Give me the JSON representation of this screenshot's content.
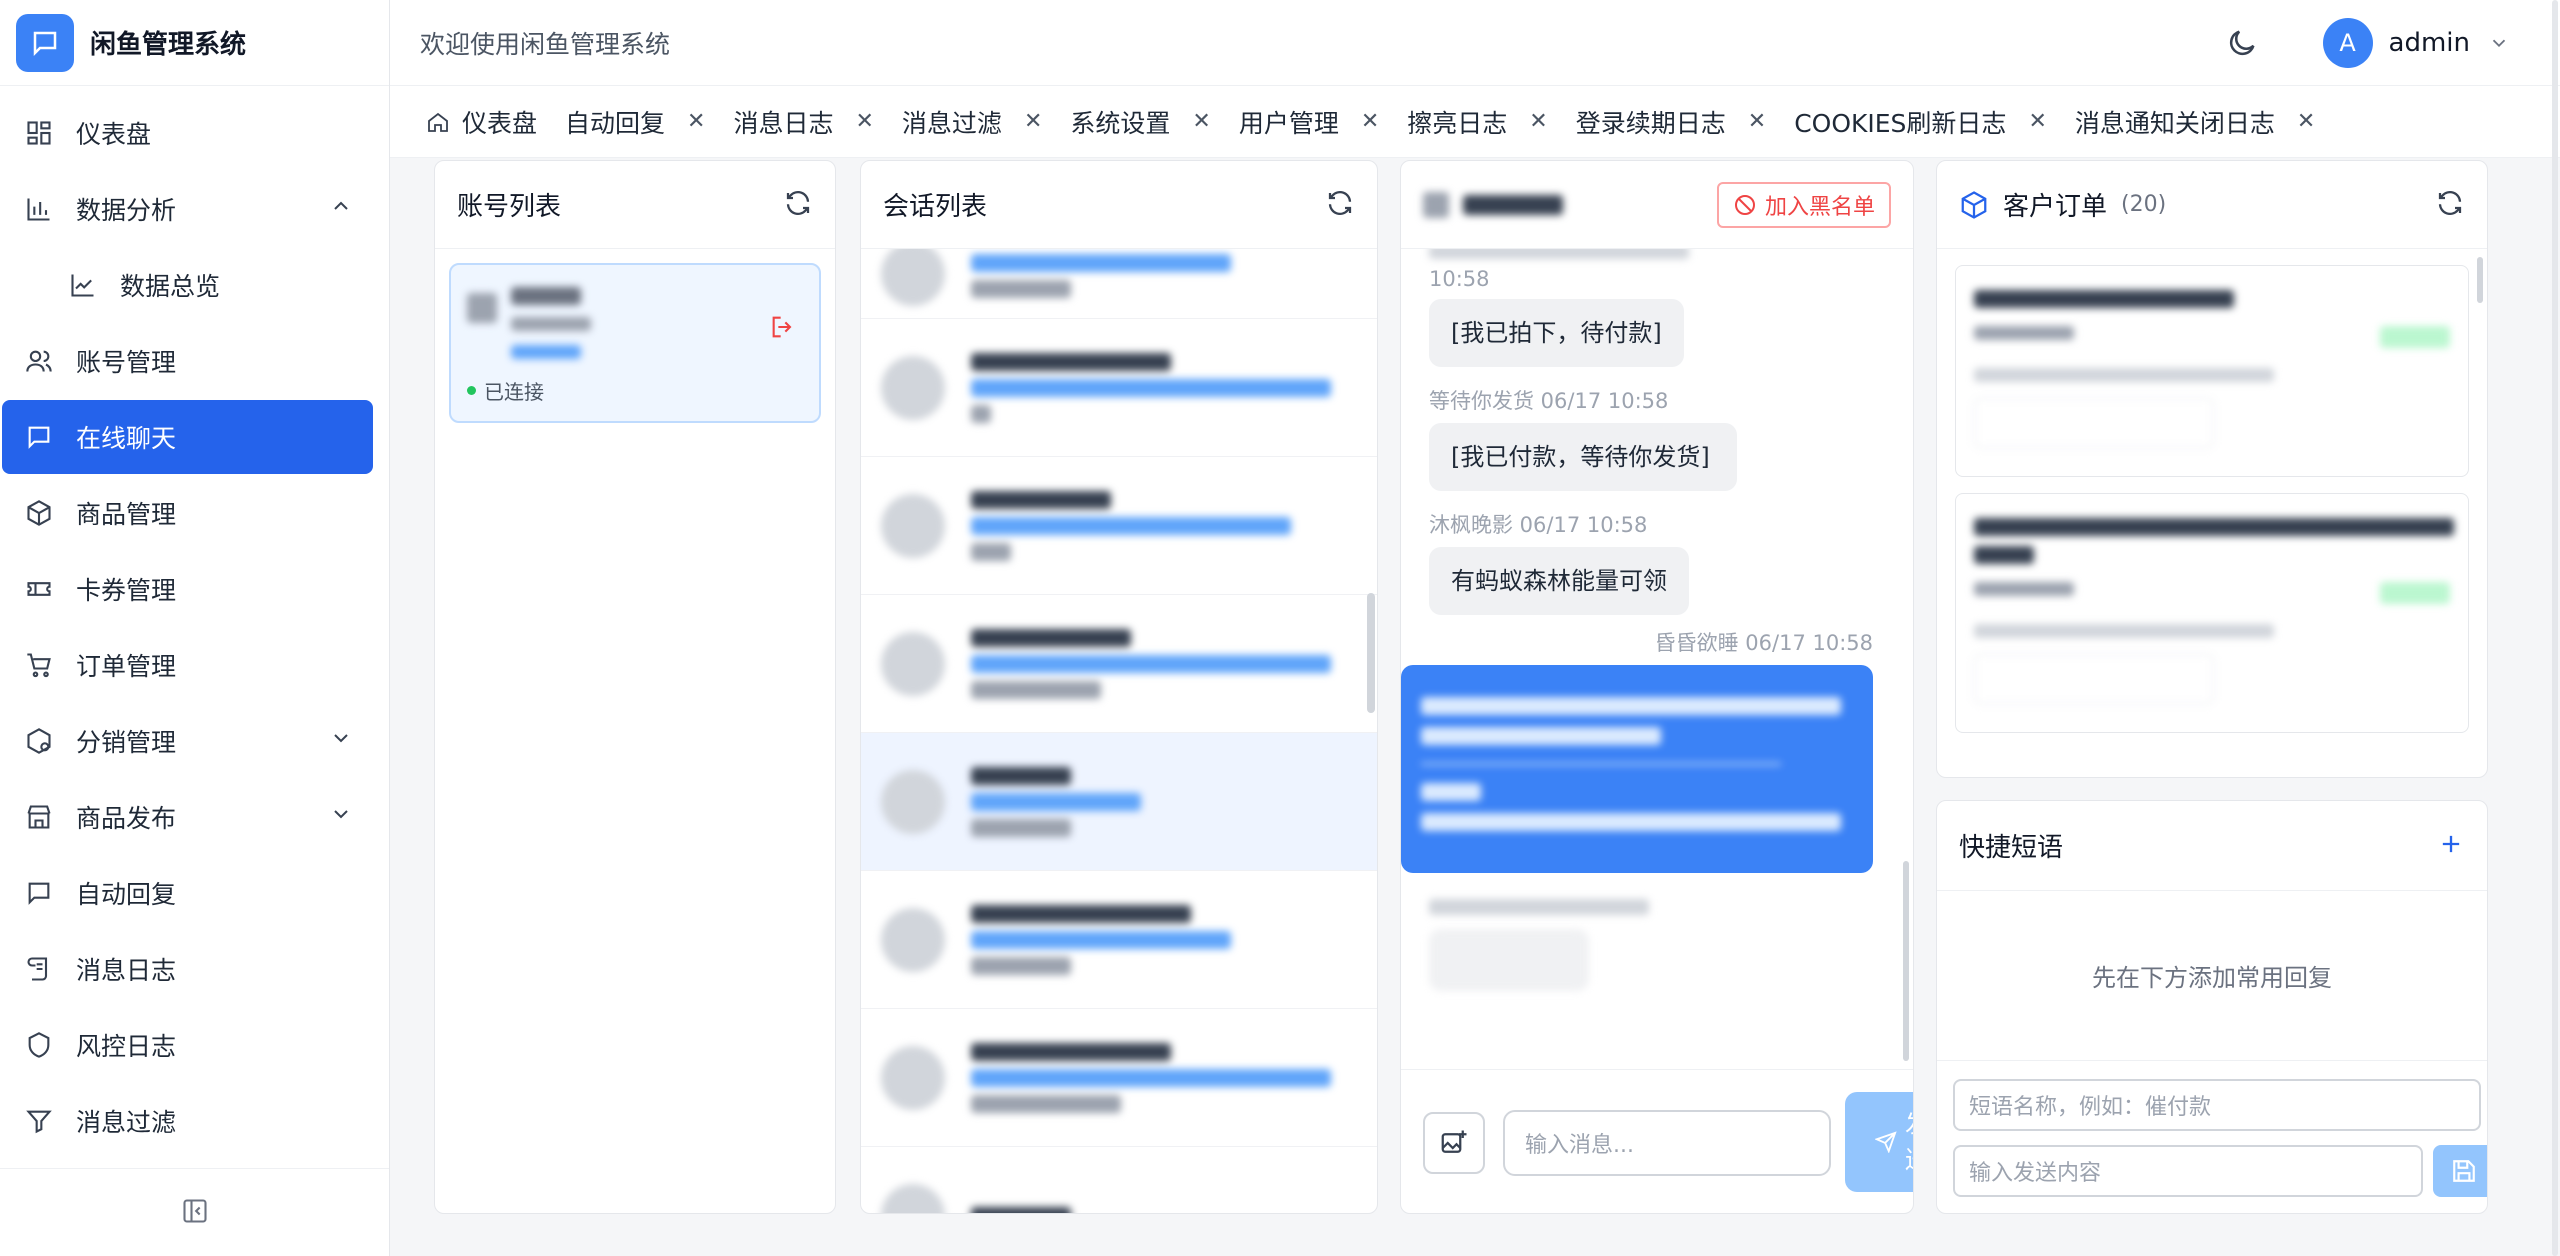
{
  "app": {
    "title": "闲鱼管理系统"
  },
  "header": {
    "welcome": "欢迎使用闲鱼管理系统",
    "avatar_letter": "A",
    "user": "admin"
  },
  "sidebar": {
    "items": [
      {
        "label": "仪表盘",
        "icon": "dashboard-icon"
      },
      {
        "label": "数据分析",
        "icon": "chart-icon",
        "expanded": true
      },
      {
        "label": "数据总览",
        "icon": "trend-icon",
        "sub": true
      },
      {
        "label": "账号管理",
        "icon": "users-icon"
      },
      {
        "label": "在线聊天",
        "icon": "chat-icon",
        "active": true
      },
      {
        "label": "商品管理",
        "icon": "box-icon"
      },
      {
        "label": "卡券管理",
        "icon": "ticket-icon"
      },
      {
        "label": "订单管理",
        "icon": "cart-icon"
      },
      {
        "label": "分销管理",
        "icon": "distribution-icon",
        "collapsed": true
      },
      {
        "label": "商品发布",
        "icon": "store-icon",
        "collapsed": true
      },
      {
        "label": "自动回复",
        "icon": "reply-icon"
      },
      {
        "label": "消息日志",
        "icon": "scroll-icon"
      },
      {
        "label": "风控日志",
        "icon": "shield-icon"
      },
      {
        "label": "消息过滤",
        "icon": "filter-icon"
      }
    ]
  },
  "tabs": [
    {
      "label": "仪表盘",
      "home": true
    },
    {
      "label": "自动回复"
    },
    {
      "label": "消息日志"
    },
    {
      "label": "消息过滤"
    },
    {
      "label": "系统设置"
    },
    {
      "label": "用户管理"
    },
    {
      "label": "擦亮日志"
    },
    {
      "label": "登录续期日志"
    },
    {
      "label": "COOKIES刷新日志"
    },
    {
      "label": "消息通知关闭日志"
    }
  ],
  "accounts_panel": {
    "title": "账号列表",
    "status": "已连接"
  },
  "conversations_panel": {
    "title": "会话列表"
  },
  "chat_panel": {
    "blacklist_label": "加入黑名单",
    "messages": [
      {
        "meta": "10:58",
        "text": "[我已拍下，待付款]"
      },
      {
        "meta": "等待你发货   06/17 10:58",
        "text": "[我已付款，等待你发货]"
      },
      {
        "meta": "沐枫晚影   06/17 10:58",
        "text": "有蚂蚁森林能量可领"
      }
    ],
    "my_meta": "昏昏欲睡   06/17 10:58",
    "input_placeholder": "输入消息...",
    "send_label": "发送"
  },
  "orders_panel": {
    "title": "客户订单",
    "count": "(20)"
  },
  "phrases_panel": {
    "title": "快捷短语",
    "empty": "先在下方添加常用回复",
    "name_placeholder": "短语名称，例如：催付款",
    "content_placeholder": "输入发送内容"
  },
  "colors": {
    "primary": "#2563eb",
    "accent": "#3b82f6",
    "danger": "#ef4444"
  }
}
